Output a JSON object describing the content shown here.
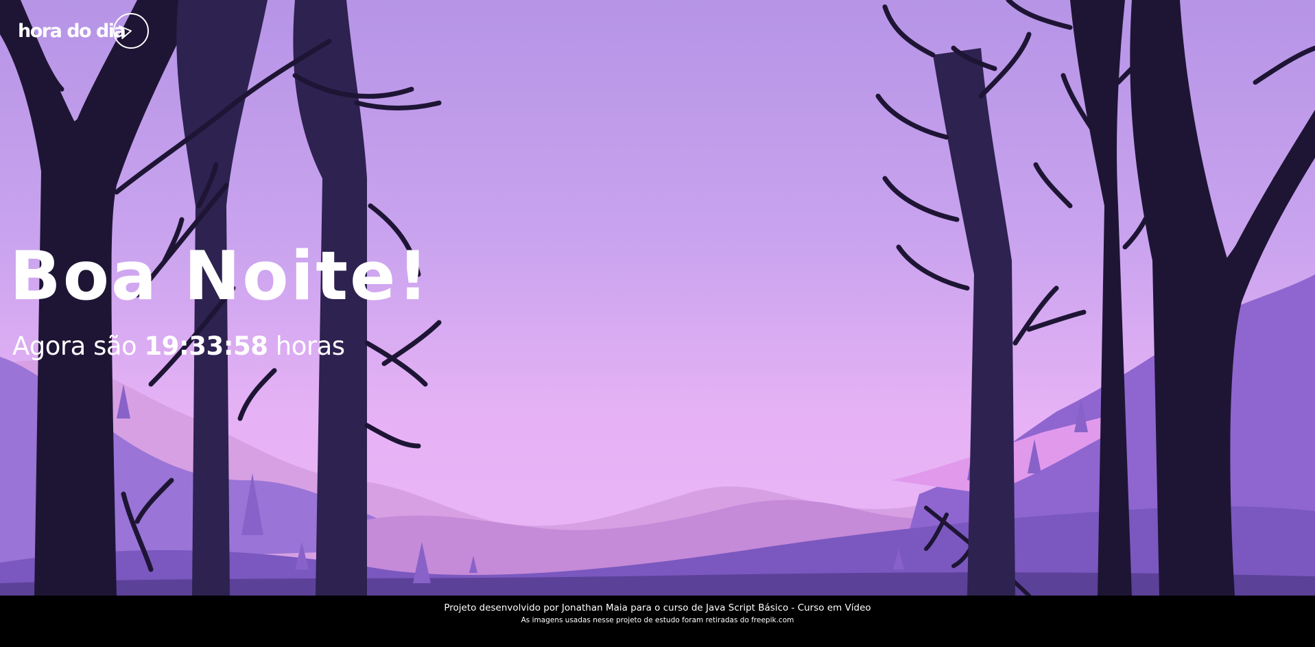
{
  "header": {
    "logo_text": "hora do dia"
  },
  "main": {
    "greeting": "Boa Noite!",
    "time_prefix": "Agora são",
    "time_value": "19:33:58",
    "time_suffix": "horas",
    "background_image": "night-forest-landscape"
  },
  "footer": {
    "credit_line": "Projeto desenvolvido por Jonathan Maia para o curso de Java Script Básico - Curso em Vídeo",
    "images_line": "As imagens usadas nesse projeto de estudo foram retiradas do freepik.com"
  },
  "colors": {
    "sky_top": "#b694e6",
    "sky_bottom": "#eab6f6",
    "tree_dark": "#1e1535",
    "tree_mid": "#2d2250",
    "hill_purple": "#8e6ad0",
    "footer_bg": "#000000",
    "text": "#ffffff"
  }
}
